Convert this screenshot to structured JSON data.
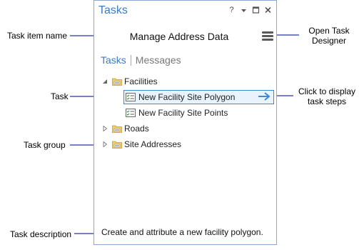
{
  "pane": {
    "title": "Tasks",
    "controls": {
      "help": "?",
      "pin": "▾"
    },
    "task_name": "Manage Address Data",
    "tabs": [
      {
        "label": "Tasks",
        "active": true
      },
      {
        "label": "Messages",
        "active": false
      }
    ],
    "tree": {
      "groups": [
        {
          "label": "Facilities",
          "expanded": true,
          "tasks": [
            {
              "label": "New Facility Site Polygon",
              "selected": true
            },
            {
              "label": "New Facility Site Points",
              "selected": false
            }
          ]
        },
        {
          "label": "Roads",
          "expanded": false
        },
        {
          "label": "Site Addresses",
          "expanded": false
        }
      ]
    },
    "description": "Create and attribute a new facility polygon."
  },
  "callouts": {
    "task_item_name": "Task item name",
    "task": "Task",
    "task_group": "Task group",
    "task_description": "Task description",
    "open_task_designer": [
      "Open Task",
      "Designer"
    ],
    "click_to_display": [
      "Click to display",
      "task steps"
    ]
  },
  "colors": {
    "accent": "#3a7bc8",
    "leader": "#7a7fc9",
    "selection_border": "#3a8ad8",
    "selection_fill": "#e9f3fd",
    "folder": "#e8b84a"
  },
  "icons": [
    "question-icon",
    "dropdown-icon",
    "maximize-icon",
    "close-icon",
    "hamburger-menu-icon",
    "folder-icon",
    "task-list-icon",
    "right-arrow-icon",
    "expand-triangle-icon",
    "collapse-triangle-icon"
  ]
}
